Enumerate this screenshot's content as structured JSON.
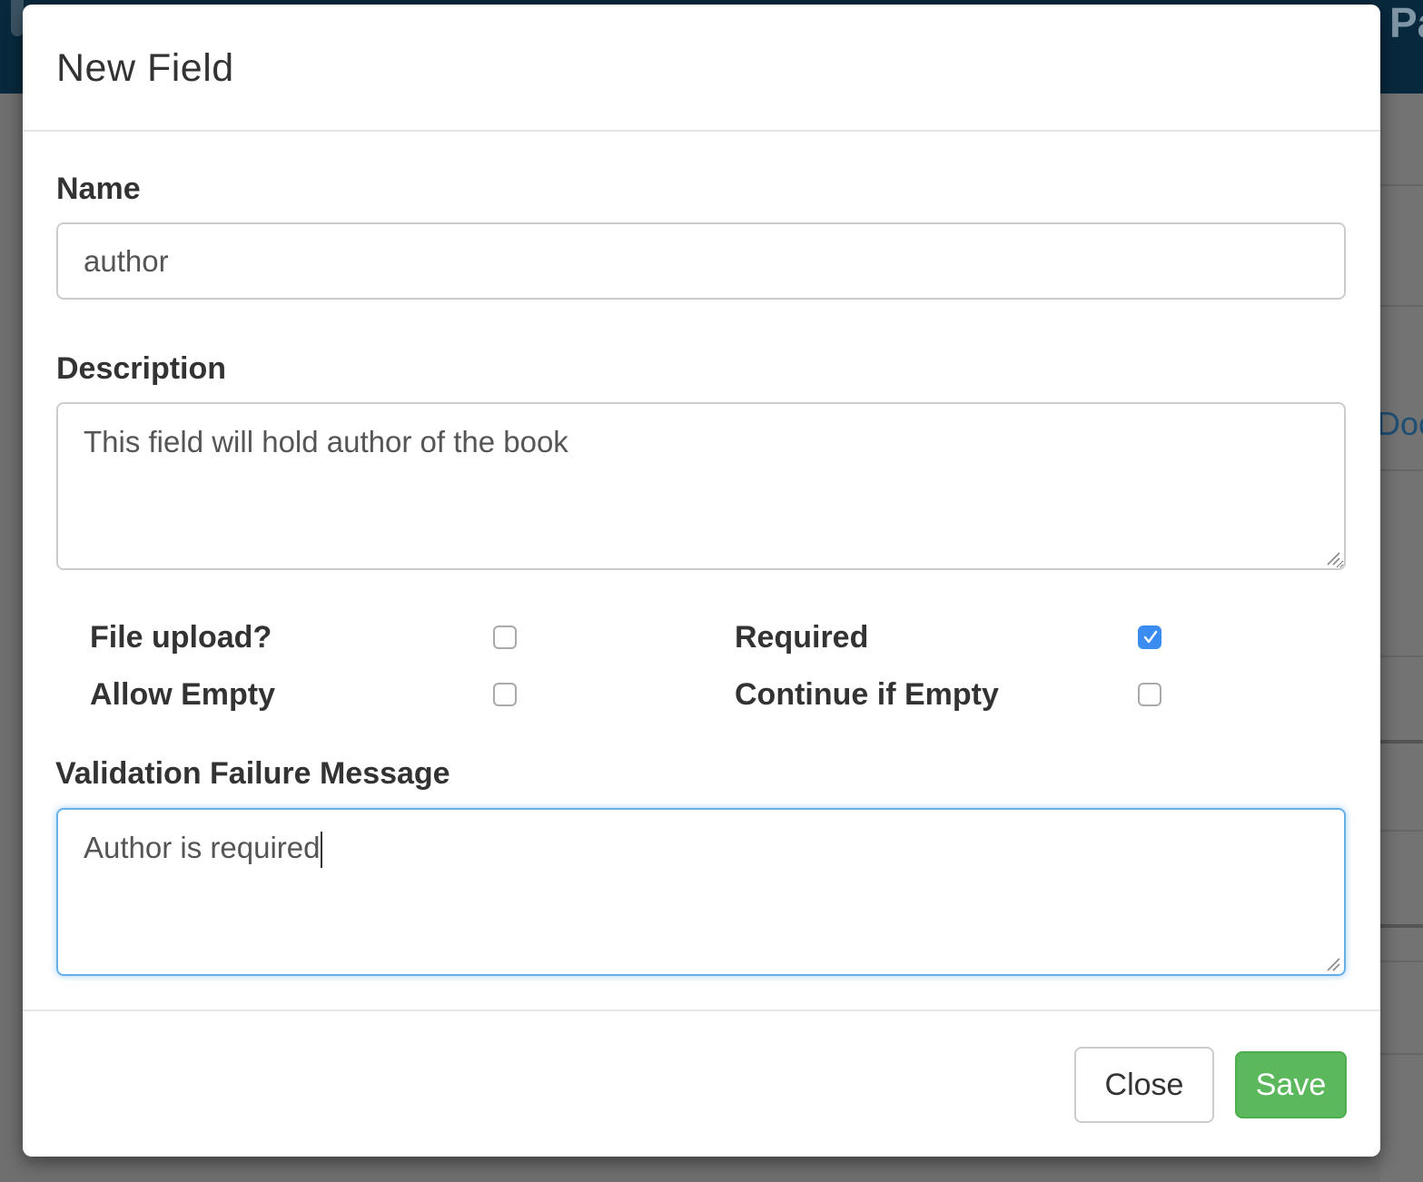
{
  "background": {
    "nav_text": "Pa",
    "link_text": "Doc"
  },
  "modal": {
    "title": "New Field",
    "name": {
      "label": "Name",
      "value": "author"
    },
    "description": {
      "label": "Description",
      "value": "This field will hold author of the book"
    },
    "options": [
      {
        "label": "File upload?",
        "checked": false
      },
      {
        "label": "Required",
        "checked": true
      },
      {
        "label": "Allow Empty",
        "checked": false
      },
      {
        "label": "Continue if Empty",
        "checked": false
      }
    ],
    "validation": {
      "label": "Validation Failure Message",
      "value": "Author is required"
    },
    "footer": {
      "close_label": "Close",
      "save_label": "Save"
    }
  },
  "colors": {
    "accent": "#3b8cf0",
    "success": "#5cb85c",
    "focus_border": "#66afe9",
    "navbar": "#08293d"
  }
}
